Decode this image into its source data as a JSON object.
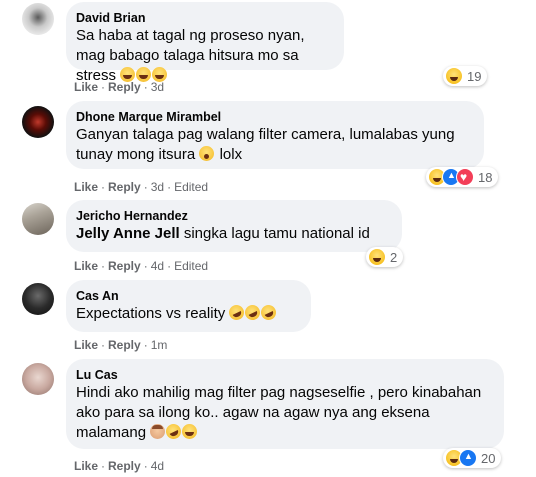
{
  "actions": {
    "like": "Like",
    "reply": "Reply",
    "dot": "·"
  },
  "comments": [
    {
      "author": "David Brian",
      "text": "Sa haba at tagal ng proseso nyan, mag babago talaga hitsura mo sa stress",
      "time": "3d",
      "edited": "",
      "reaction_count": "19",
      "reactions": [
        "haha-icon"
      ]
    },
    {
      "author": "Dhone Marque Mirambel",
      "text": "Ganyan talaga pag walang filter camera, lumalabas yung tunay mong itsura",
      "text_suffix": "lolx",
      "time": "3d",
      "edited": "Edited",
      "reaction_count": "18",
      "reactions": [
        "haha-icon",
        "like-icon",
        "love-icon"
      ]
    },
    {
      "author": "Jericho Hernandez",
      "mention": "Jelly Anne Jell",
      "text": "singka lagu tamu national id",
      "time": "4d",
      "edited": "Edited",
      "reaction_count": "2",
      "reactions": [
        "haha-icon"
      ]
    },
    {
      "author": "Cas An",
      "text": "Expectations vs reality",
      "time": "1m",
      "edited": ""
    },
    {
      "author": "Lu Cas",
      "text": "Hindi ako mahilig mag filter pag nagseselfie , pero kinabahan ako para sa ilong ko.. agaw na agaw nya ang eksena malamang",
      "time": "4d",
      "edited": "",
      "reaction_count": "20",
      "reactions": [
        "haha-icon",
        "like-icon"
      ]
    }
  ]
}
